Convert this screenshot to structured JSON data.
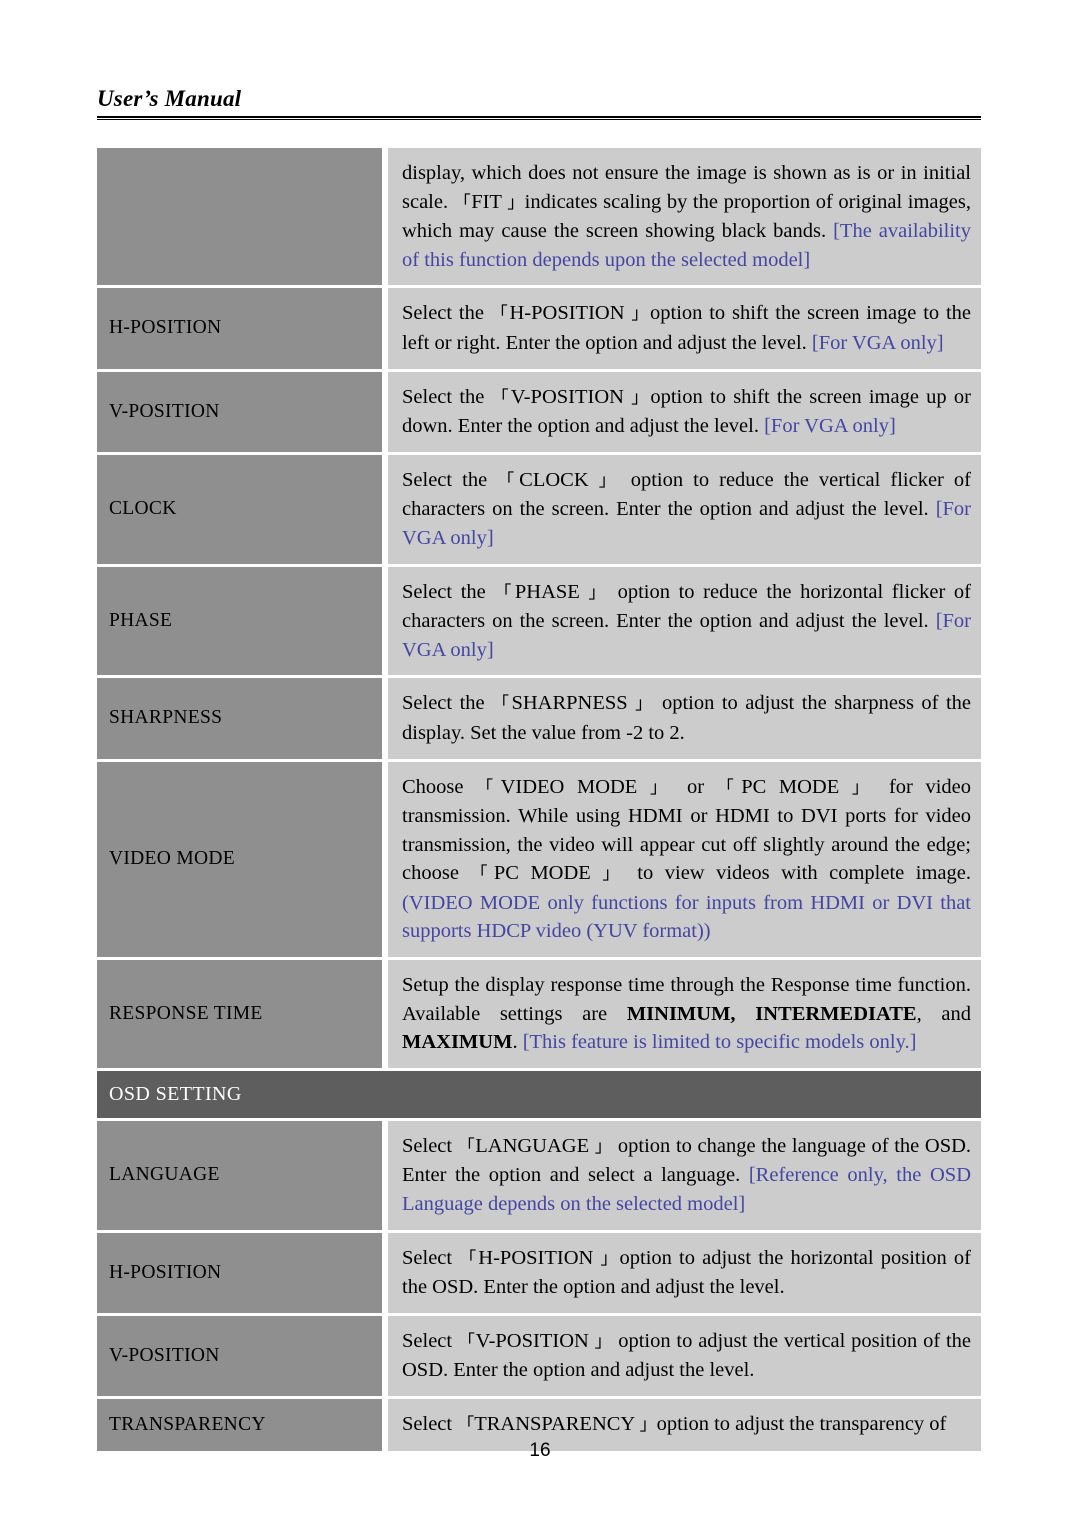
{
  "header": {
    "title": "User’s Manual"
  },
  "footer": {
    "page_number": "16"
  },
  "colors": {
    "term_cell_bg": "#8f8f8f",
    "desc_cell_bg": "#cccccc",
    "section_band_bg": "#5e5e5e",
    "note_text": "#4545a3",
    "body_text": "#000000",
    "page_bg": "#ffffff"
  },
  "table": {
    "rows": [
      {
        "term": "",
        "desc_plain": "display, which does not ensure the image is shown as is or in initial scale. 「FIT 」indicates scaling by the proportion of original images, which may cause the screen showing black bands. [The availability of this function depends upon the selected model]",
        "segments": [
          {
            "text": "display, which does not ensure the image is shown as is or in initial scale. ",
            "style": "normal"
          },
          {
            "text": "「",
            "style": "bracket"
          },
          {
            "text": "FIT ",
            "style": "normal"
          },
          {
            "text": "」",
            "style": "bracket"
          },
          {
            "text": "indicates scaling by the proportion of original images, which may cause the screen showing black bands. ",
            "style": "normal"
          },
          {
            "text": "[The availability of this function depends upon the selected model]",
            "style": "note"
          }
        ]
      },
      {
        "term": "H-POSITION",
        "desc_plain": "Select the 「H-POSITION 」option to shift the screen image to the left or right. Enter the option and adjust the level. [For VGA only]",
        "segments": [
          {
            "text": "Select the ",
            "style": "normal"
          },
          {
            "text": "「",
            "style": "bracket"
          },
          {
            "text": "H-POSITION ",
            "style": "normal"
          },
          {
            "text": "」",
            "style": "bracket"
          },
          {
            "text": "option to shift the screen image to the left or right. Enter the option and adjust the level. ",
            "style": "normal"
          },
          {
            "text": "[For VGA only]",
            "style": "note"
          }
        ]
      },
      {
        "term": "V-POSITION",
        "desc_plain": "Select the 「V-POSITION 」option to shift the screen image up or down. Enter the option and adjust the level. [For VGA only]",
        "segments": [
          {
            "text": "Select the  ",
            "style": "normal"
          },
          {
            "text": "「",
            "style": "bracket"
          },
          {
            "text": "V-POSITION ",
            "style": "normal"
          },
          {
            "text": "」",
            "style": "bracket"
          },
          {
            "text": "option to shift the screen image up or down. Enter the option and adjust the level. ",
            "style": "normal"
          },
          {
            "text": "[For VGA only]",
            "style": "note"
          }
        ]
      },
      {
        "term": "CLOCK",
        "desc_plain": "Select the 「CLOCK 」option to reduce the vertical flicker of characters on the screen. Enter the option and adjust the level. [For VGA only]",
        "segments": [
          {
            "text": "Select the  ",
            "style": "normal"
          },
          {
            "text": "「",
            "style": "bracket"
          },
          {
            "text": "CLOCK ",
            "style": "normal"
          },
          {
            "text": "」",
            "style": "bracket"
          },
          {
            "text": " option to reduce the vertical flicker of characters on the screen. Enter the option and adjust the level. ",
            "style": "normal"
          },
          {
            "text": "[For VGA only]",
            "style": "note"
          }
        ]
      },
      {
        "term": "PHASE",
        "desc_plain": "Select the 「PHASE 」option to reduce the horizontal flicker of characters on the screen. Enter the option and adjust the level. [For VGA only]",
        "segments": [
          {
            "text": "Select the ",
            "style": "normal"
          },
          {
            "text": "「",
            "style": "bracket"
          },
          {
            "text": "PHASE ",
            "style": "normal"
          },
          {
            "text": "」",
            "style": "bracket"
          },
          {
            "text": " option to reduce the horizontal flicker of characters on the screen. Enter the option and adjust the level. ",
            "style": "normal"
          },
          {
            "text": "[For VGA only]",
            "style": "note"
          }
        ]
      },
      {
        "term": "SHARPNESS",
        "desc_plain": "Select the 「SHARPNESS 」 option to adjust the sharpness of the display. Set the value from -2 to 2.",
        "segments": [
          {
            "text": "Select the ",
            "style": "normal"
          },
          {
            "text": "「",
            "style": "bracket"
          },
          {
            "text": "SHARPNESS ",
            "style": "normal"
          },
          {
            "text": "」",
            "style": "bracket"
          },
          {
            "text": " option to adjust the sharpness of the display. Set the value from -2 to 2.",
            "style": "normal"
          }
        ]
      },
      {
        "term": "VIDEO MODE",
        "desc_plain": "Choose 「VIDEO MODE 」or 「PC MODE 」for video transmission. While using HDMI or HDMI to DVI ports for video transmission, the video will appear cut off slightly around the edge; choose 「PC MODE 」to view videos with complete image. (VIDEO MODE only functions for inputs from HDMI or DVI that supports HDCP video (YUV format))",
        "segments": [
          {
            "text": "Choose ",
            "style": "normal"
          },
          {
            "text": "「",
            "style": "bracket"
          },
          {
            "text": "VIDEO MODE ",
            "style": "normal"
          },
          {
            "text": "」",
            "style": "bracket"
          },
          {
            "text": " or  ",
            "style": "normal"
          },
          {
            "text": "「",
            "style": "bracket"
          },
          {
            "text": "PC MODE ",
            "style": "normal"
          },
          {
            "text": "」",
            "style": "bracket"
          },
          {
            "text": " for video transmission. While using HDMI or HDMI to DVI ports for video transmission, the video will appear cut off slightly around the edge; choose ",
            "style": "normal"
          },
          {
            "text": "「",
            "style": "bracket"
          },
          {
            "text": "PC MODE ",
            "style": "normal"
          },
          {
            "text": "」",
            "style": "bracket"
          },
          {
            "text": " to view videos with complete image. ",
            "style": "normal"
          },
          {
            "text": "(VIDEO MODE only functions for inputs from HDMI or DVI that supports HDCP video (YUV format))",
            "style": "note"
          }
        ]
      },
      {
        "term": "RESPONSE TIME",
        "desc_plain": "Setup the display response time through the Response time function. Available settings are MINIMUM, INTERMEDIATE, and MAXIMUM. [This feature is limited to specific models only.]",
        "segments": [
          {
            "text": "Setup the display response time through the Response time function. Available settings are ",
            "style": "normal"
          },
          {
            "text": "MINIMUM,",
            "style": "bold"
          },
          {
            "text": " ",
            "style": "normal"
          },
          {
            "text": "INTERMEDIATE",
            "style": "bold"
          },
          {
            "text": ", and ",
            "style": "normal"
          },
          {
            "text": "MAXIMUM",
            "style": "bold"
          },
          {
            "text": ". ",
            "style": "normal"
          },
          {
            "text": "[This feature is limited to specific models only.]",
            "style": "note"
          }
        ]
      }
    ],
    "section_band": {
      "label": "OSD SETTING"
    },
    "osd_rows": [
      {
        "term": "LANGUAGE",
        "desc_plain": "Select 「LANGUAGE 」 option to change the language of the OSD. Enter the option and select a language. [Reference only, the OSD Language depends on the selected model]",
        "segments": [
          {
            "text": "Select  ",
            "style": "normal"
          },
          {
            "text": "「",
            "style": "bracket"
          },
          {
            "text": "LANGUAGE ",
            "style": "normal"
          },
          {
            "text": "」",
            "style": "bracket"
          },
          {
            "text": "  option to change the language of the OSD. Enter the option and select a language. ",
            "style": "normal"
          },
          {
            "text": "[Reference only, the OSD Language depends on the selected model]",
            "style": "note"
          }
        ]
      },
      {
        "term": "H-POSITION",
        "desc_plain": "Select 「H-POSITION 」option to adjust the horizontal position of the OSD. Enter the option and adjust the level.",
        "segments": [
          {
            "text": "Select ",
            "style": "normal"
          },
          {
            "text": "「",
            "style": "bracket"
          },
          {
            "text": "H-POSITION ",
            "style": "normal"
          },
          {
            "text": "」",
            "style": "bracket"
          },
          {
            "text": "option to adjust the horizontal position of the OSD. Enter the option and adjust the level.",
            "style": "normal"
          }
        ]
      },
      {
        "term": "V-POSITION",
        "desc_plain": "Select 「V-POSITION 」 option to adjust the vertical position of the OSD. Enter the option and adjust the level.",
        "segments": [
          {
            "text": "Select  ",
            "style": "normal"
          },
          {
            "text": "「",
            "style": "bracket"
          },
          {
            "text": "V-POSITION ",
            "style": "normal"
          },
          {
            "text": "」",
            "style": "bracket"
          },
          {
            "text": " option to adjust the vertical position of the OSD. Enter the option and adjust the level.",
            "style": "normal"
          }
        ]
      },
      {
        "term": "TRANSPARENCY",
        "desc_plain": "Select 「TRANSPARENCY 」option to adjust the transparency of",
        "segments": [
          {
            "text": "Select ",
            "style": "normal"
          },
          {
            "text": "「",
            "style": "bracket"
          },
          {
            "text": "TRANSPARENCY ",
            "style": "normal"
          },
          {
            "text": "」",
            "style": "bracket"
          },
          {
            "text": "option to adjust the transparency of",
            "style": "normal"
          }
        ]
      }
    ]
  }
}
